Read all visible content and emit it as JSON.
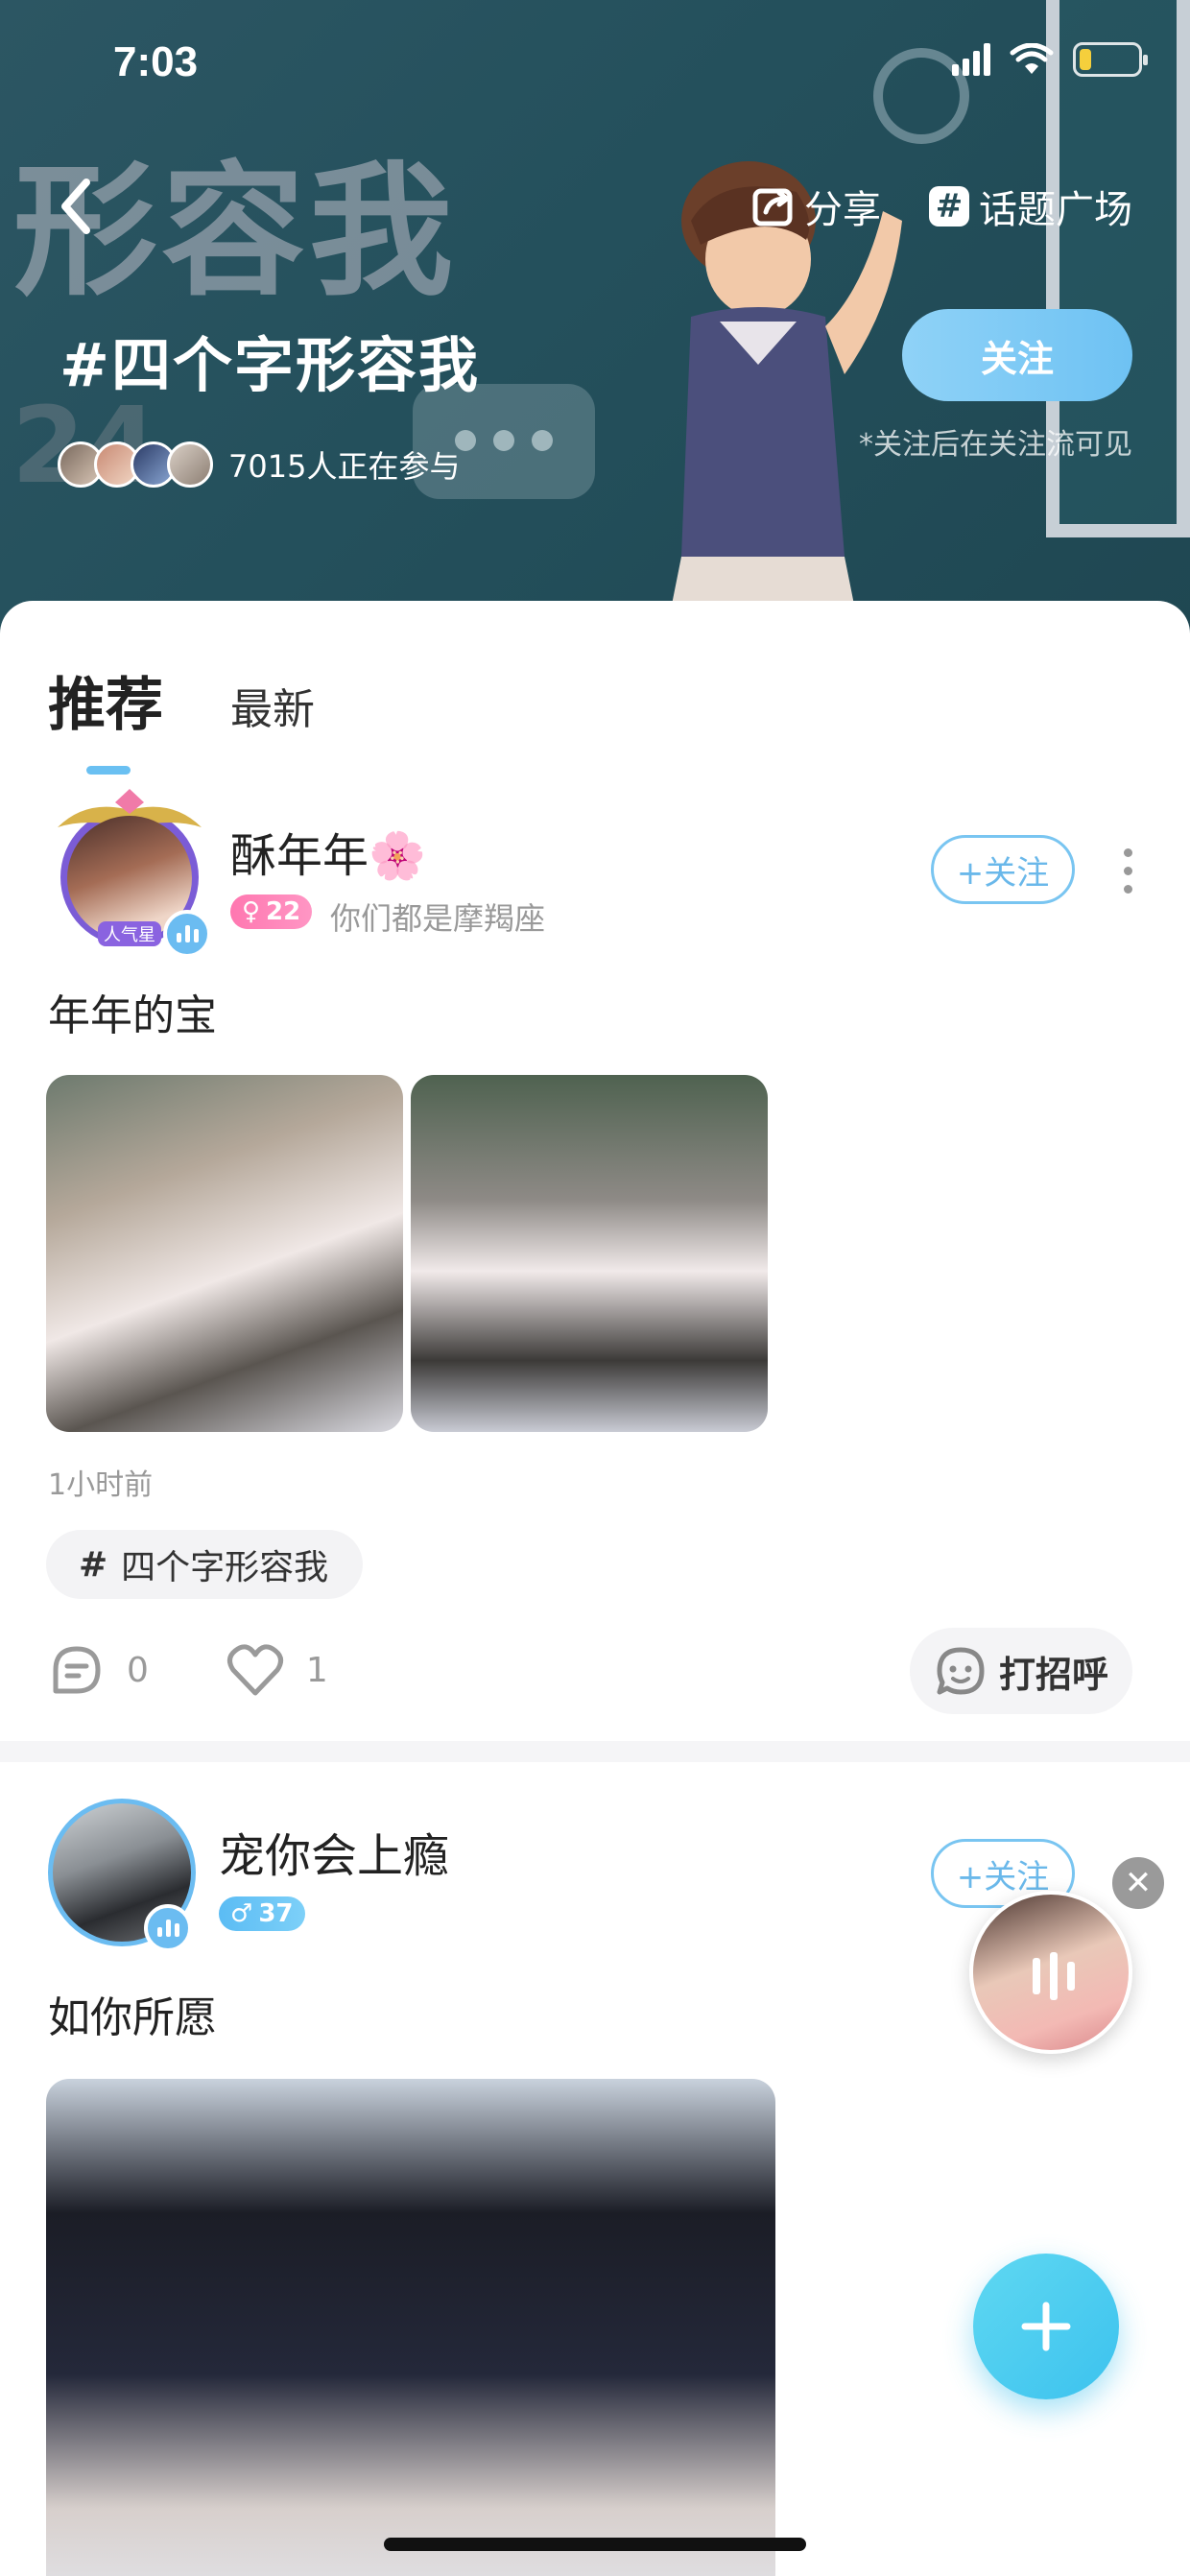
{
  "status_bar": {
    "time": "7:03"
  },
  "header": {
    "background_text": "形容我",
    "background_number": "24",
    "share_label": "分享",
    "topic_square_label": "话题广场",
    "topic_title": "#四个字形容我",
    "participants_text": "7015人正在参与",
    "follow_label": "关注",
    "follow_hint": "*关注后在关注流可见"
  },
  "tabs": [
    {
      "label": "推荐",
      "active": true
    },
    {
      "label": "最新",
      "active": false
    }
  ],
  "posts": [
    {
      "user_name": "酥年年🌸",
      "avatar_badge": "人气星",
      "gender": "female",
      "age": "22",
      "signature": "你们都是摩羯座",
      "follow_label": "+关注",
      "text": "年年的宝",
      "time": "1小时前",
      "topic_hash": "#",
      "topic": "四个字形容我",
      "comments": "0",
      "likes": "1",
      "greet_label": "打招呼"
    },
    {
      "user_name": "宠你会上瘾",
      "gender": "male",
      "age": "37",
      "follow_label": "+关注",
      "text": "如你所愿"
    }
  ],
  "colors": {
    "accent": "#6ac0f2",
    "banner": "#24505c",
    "fab": "#3cc2ee",
    "female_tag": "#ff77b0",
    "male_tag": "#5bbcf4"
  },
  "icons": [
    "back-icon",
    "share-icon",
    "hash-icon",
    "comment-icon",
    "heart-icon",
    "greet-icon",
    "more-icon",
    "close-icon",
    "plus-icon"
  ]
}
